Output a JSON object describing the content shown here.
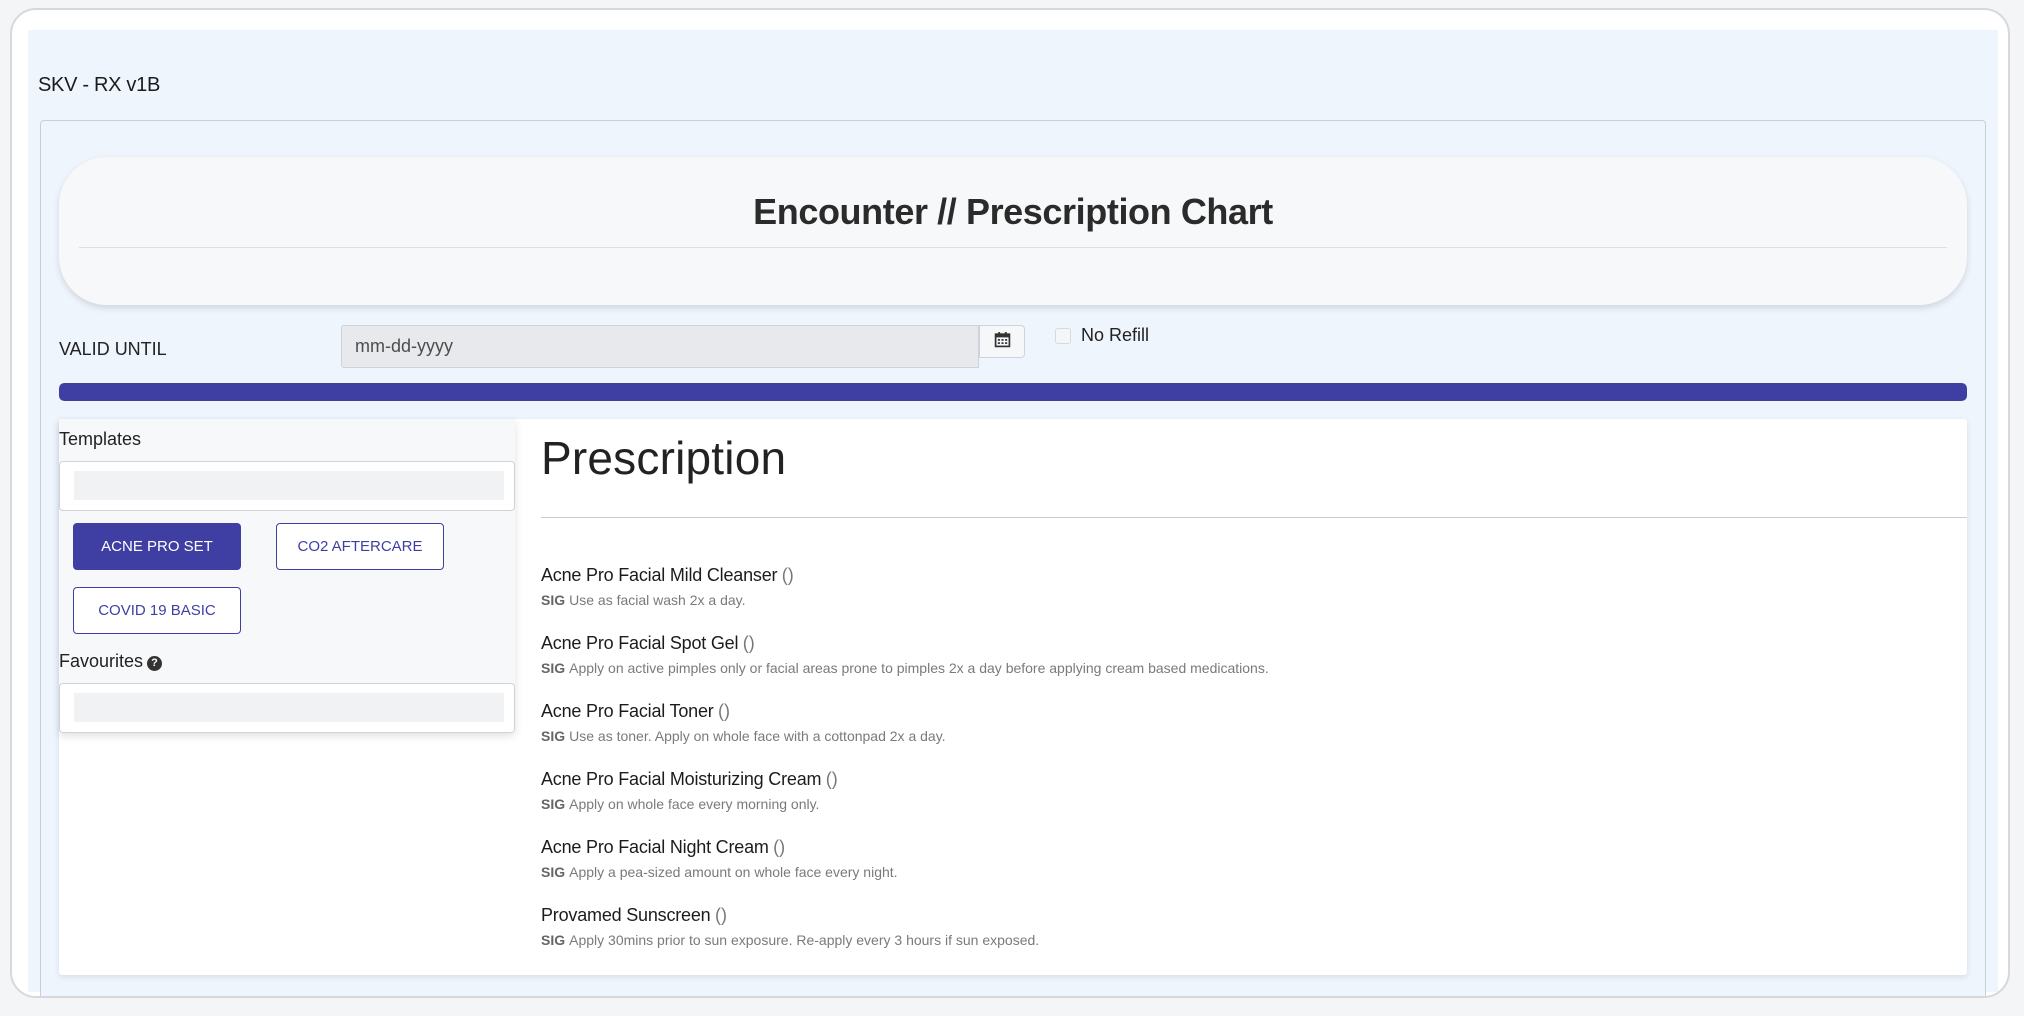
{
  "app": {
    "title": "SKV - RX v1B"
  },
  "header": {
    "title": "Encounter // Prescription Chart"
  },
  "valid_until": {
    "label": "VALID UNTIL",
    "value": "",
    "placeholder": "mm-dd-yyyy",
    "calendar_icon": "calendar-icon"
  },
  "no_refill": {
    "label": "No Refill",
    "checked": false
  },
  "progress": {
    "percent": 100,
    "color": "#3f3fa3"
  },
  "templates": {
    "label": "Templates",
    "search_value": "",
    "buttons": [
      {
        "label": "ACNE PRO SET",
        "active": true
      },
      {
        "label": "CO2 AFTERCARE",
        "active": false
      },
      {
        "label": "COVID 19 BASIC",
        "active": false
      }
    ]
  },
  "favourites": {
    "label": "Favourites",
    "help_icon": "question-circle-icon",
    "search_value": ""
  },
  "prescription": {
    "title": "Prescription",
    "sig_label": "SIG",
    "items": [
      {
        "name": "Acne Pro Facial Mild Cleanser",
        "paren": "()",
        "sig": "Use as facial wash 2x a day."
      },
      {
        "name": "Acne Pro Facial Spot Gel",
        "paren": "()",
        "sig": "Apply on active pimples only or facial areas prone to pimples 2x a day before applying cream based medications."
      },
      {
        "name": "Acne Pro Facial Toner",
        "paren": "()",
        "sig": "Use as toner. Apply on whole face with a cottonpad 2x a day."
      },
      {
        "name": "Acne Pro Facial Moisturizing Cream",
        "paren": "()",
        "sig": "Apply on whole face every morning only."
      },
      {
        "name": "Acne Pro Facial Night Cream",
        "paren": "()",
        "sig": "Apply a pea-sized amount on whole face every night."
      },
      {
        "name": "Provamed Sunscreen",
        "paren": "()",
        "sig": "Apply 30mins prior to sun exposure. Re-apply every 3 hours if sun exposed."
      }
    ]
  },
  "colors": {
    "accent": "#3f3fa3",
    "page_background": "#eff5fd"
  }
}
